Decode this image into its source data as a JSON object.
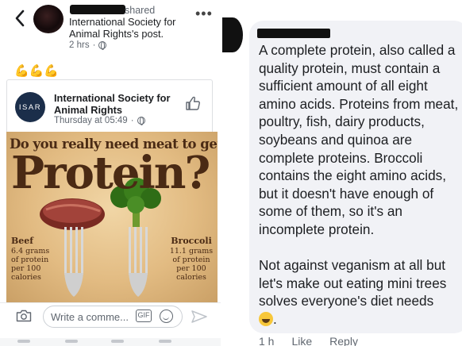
{
  "post": {
    "shared_label": "shared",
    "title": "International Society for Animal Rights's post.",
    "time": "2 hrs",
    "emojis": "💪💪💪",
    "more": "•••"
  },
  "shared_card": {
    "logo_text": "ISAR",
    "page_name": "International Society for Animal Rights",
    "time": "Thursday at 05:49"
  },
  "poster": {
    "headline": "Do you really need meat to get",
    "big_word": "Protein?",
    "left_label": {
      "title": "Beef",
      "lines": [
        "6.4 grams",
        "of protein",
        "per 100",
        "calories"
      ]
    },
    "right_label": {
      "title": "Broccoli",
      "lines": [
        "11.1 grams",
        "of protein",
        "per 100",
        "calories"
      ]
    }
  },
  "comment_bar": {
    "placeholder": "Write a comme...",
    "gif_label": "GIF"
  },
  "reply": {
    "paragraph1": "A complete protein, also called a quality protein, must contain a sufficient amount of all eight amino acids. Proteins from meat, poultry, fish, dairy products, soybeans and quinoa are complete proteins. Broccoli contains the eight amino acids, but it doesn't have enough of some of them, so it's an incomplete protein.",
    "paragraph2": "Not against veganism at all but let's make out eating mini trees solves everyone's diet needs",
    "paragraph2_end": ".",
    "time": "1 h",
    "like": "Like",
    "reply": "Reply"
  }
}
